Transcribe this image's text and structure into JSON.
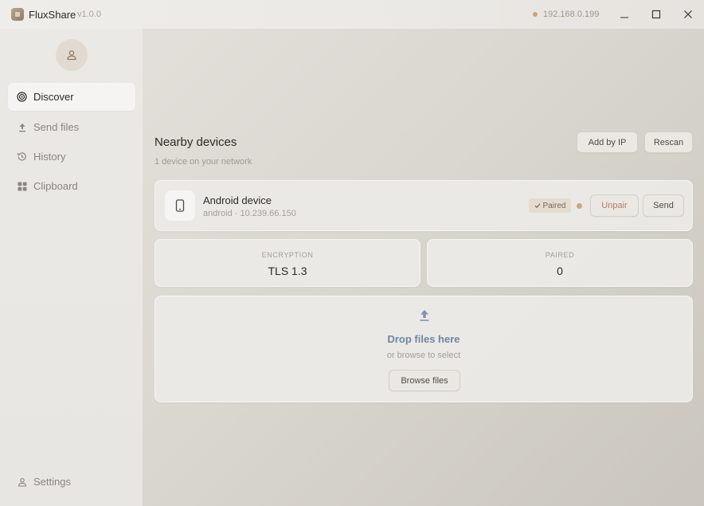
{
  "titlebar": {
    "app_name": "FluxShare",
    "version": "v1.0.0",
    "ip_address": "192.168.0.199"
  },
  "sidebar": {
    "items": [
      {
        "label": "Discover",
        "icon": "radar-icon",
        "active": true
      },
      {
        "label": "Send files",
        "icon": "upload-icon",
        "active": false
      },
      {
        "label": "History",
        "icon": "history-icon",
        "active": false
      },
      {
        "label": "Clipboard",
        "icon": "grid-icon",
        "active": false
      }
    ],
    "settings_label": "Settings"
  },
  "main": {
    "title": "Nearby devices",
    "subtitle": "1 device on your network",
    "add_by_ip_label": "Add by IP",
    "rescan_label": "Rescan",
    "device": {
      "name": "Android device",
      "meta": "android · 10.239.66.150",
      "badge": "Paired",
      "unpair_label": "Unpair",
      "send_label": "Send"
    },
    "stats": {
      "encryption_label": "ENCRYPTION",
      "encryption_value": "TLS 1.3",
      "paired_label": "PAIRED",
      "paired_value": "0"
    },
    "dropzone": {
      "title": "Drop files here",
      "subtitle": "or browse to select",
      "browse_label": "Browse files"
    }
  },
  "colors": {
    "accent": "#6d87a2",
    "status_dot": "#cda77c",
    "unpair_text": "#b6786a"
  }
}
